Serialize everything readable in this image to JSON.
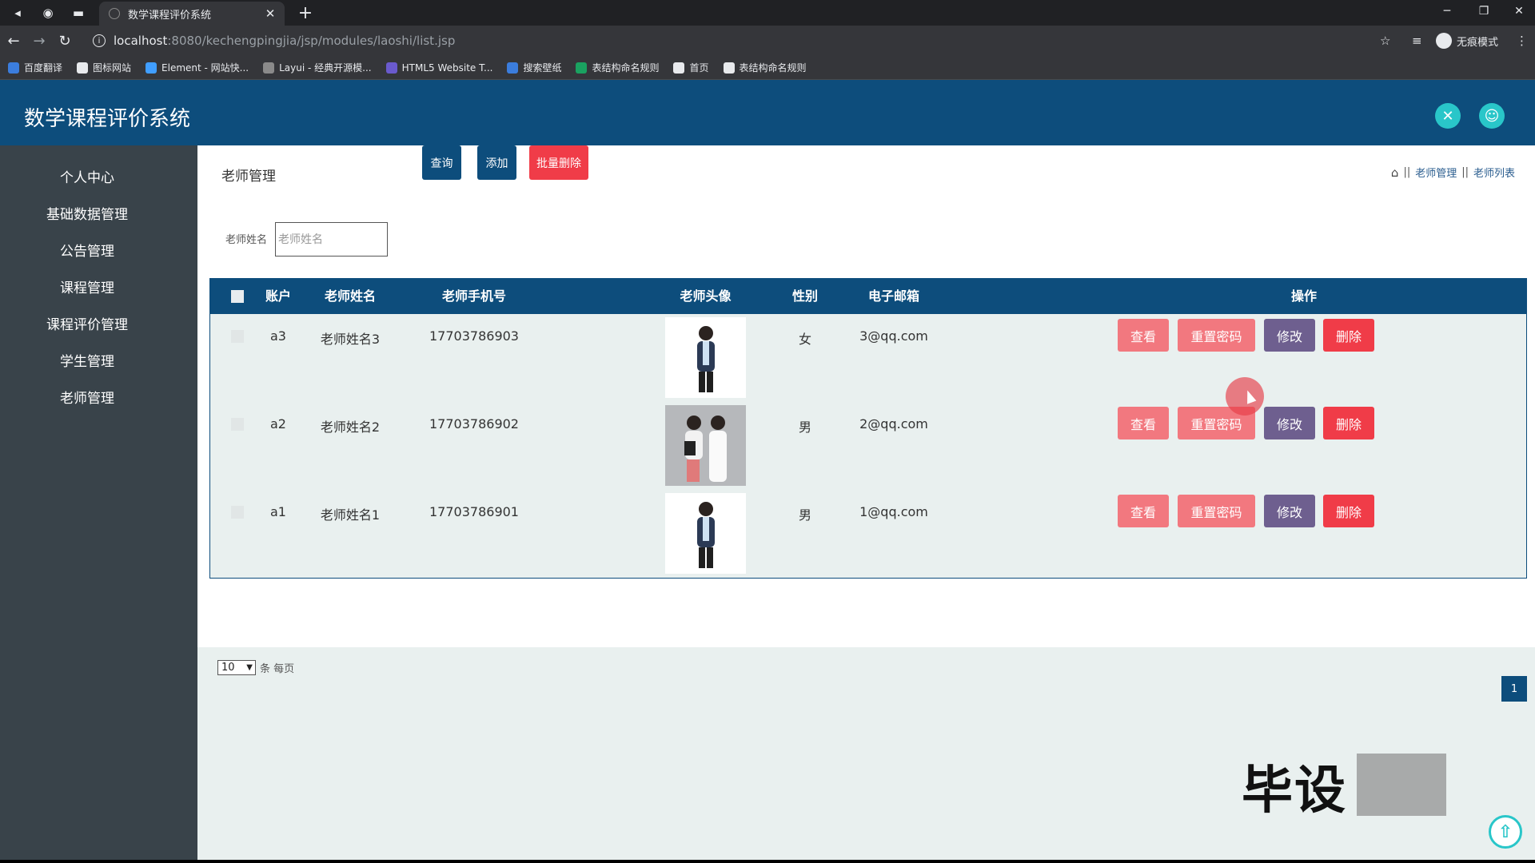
{
  "browser": {
    "tab_title": "数学课程评价系统",
    "url_host": "localhost",
    "url_path": ":8080/kechengpingjia/jsp/modules/laoshi/list.jsp",
    "incognito_label": "无痕模式",
    "bookmarks": [
      {
        "label": "百度翻译",
        "color": "#3b7ddd"
      },
      {
        "label": "图标网站",
        "color": "#e8eaed"
      },
      {
        "label": "Element - 网站快...",
        "color": "#409eff"
      },
      {
        "label": "Layui - 经典开源模...",
        "color": "#8a8a8a"
      },
      {
        "label": "HTML5 Website T...",
        "color": "#6a5acd"
      },
      {
        "label": "搜索壁纸",
        "color": "#3b7ddd"
      },
      {
        "label": "表结构命名规则",
        "color": "#1aa260"
      },
      {
        "label": "首页",
        "color": "#e8eaed"
      },
      {
        "label": "表结构命名规则",
        "color": "#e8eaed"
      }
    ]
  },
  "app": {
    "title": "数学课程评价系统",
    "colors": {
      "primary": "#0d4d7c",
      "accent": "#29c6c9",
      "danger": "#f03c48",
      "soft_red": "#f2787f",
      "purple": "#6e5f8f"
    }
  },
  "sidebar": {
    "items": [
      "个人中心",
      "基础数据管理",
      "公告管理",
      "课程管理",
      "课程评价管理",
      "学生管理",
      "老师管理"
    ]
  },
  "page": {
    "title": "老师管理",
    "breadcrumb": [
      "老师管理",
      "老师列表"
    ],
    "search_label": "老师姓名",
    "search_placeholder": "老师姓名",
    "btn_query": "查询",
    "btn_add": "添加",
    "btn_batch_delete": "批量删除"
  },
  "table": {
    "headers": [
      "账户",
      "老师姓名",
      "老师手机号",
      "老师头像",
      "性别",
      "电子邮箱",
      "操作"
    ],
    "rows": [
      {
        "account": "a3",
        "name": "老师姓名3",
        "phone": "17703786903",
        "gender": "女",
        "email": "3@qq.com"
      },
      {
        "account": "a2",
        "name": "老师姓名2",
        "phone": "17703786902",
        "gender": "男",
        "email": "2@qq.com"
      },
      {
        "account": "a1",
        "name": "老师姓名1",
        "phone": "17703786901",
        "gender": "男",
        "email": "1@qq.com"
      }
    ],
    "actions": {
      "view": "查看",
      "reset": "重置密码",
      "edit": "修改",
      "delete": "删除"
    }
  },
  "pagination": {
    "page_size": "10",
    "per_page_label": "条 每页",
    "current_page": "1"
  },
  "watermark": "毕设"
}
